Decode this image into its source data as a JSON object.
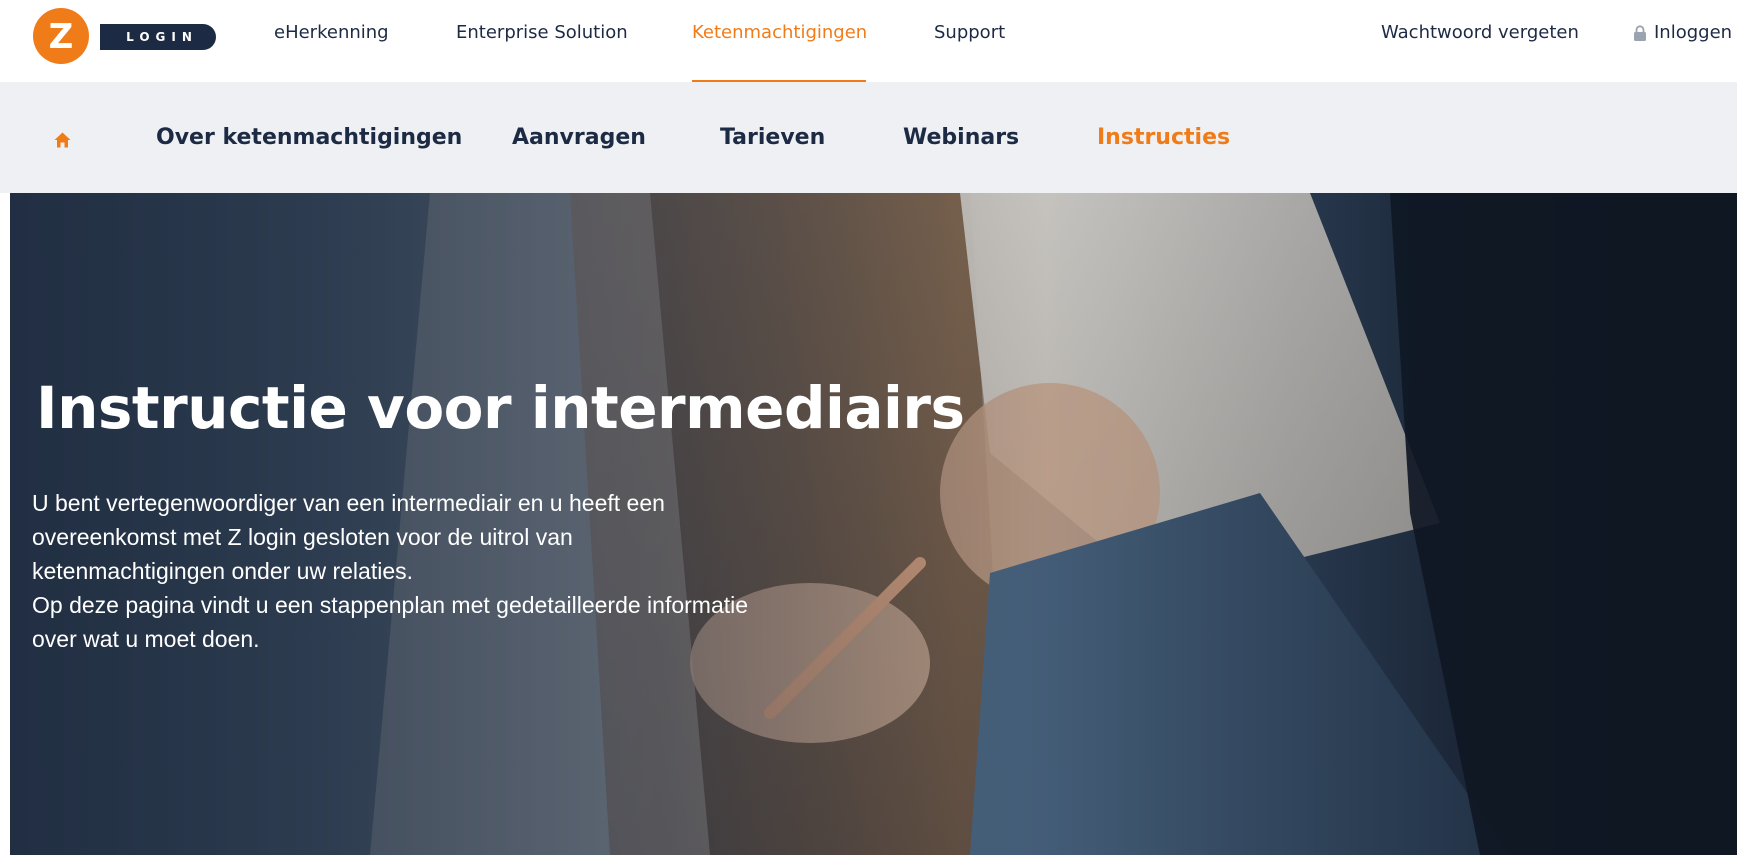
{
  "brand": {
    "logo_letter": "Z",
    "logo_word": "LOGIN",
    "orange": "#f07c19",
    "navy": "#1d2a44"
  },
  "top_nav": {
    "items": [
      {
        "label": "eHerkenning"
      },
      {
        "label": "Enterprise Solution"
      },
      {
        "label": "Ketenmachtigingen",
        "active": true
      },
      {
        "label": "Support"
      }
    ],
    "forgot_password": "Wachtwoord vergeten",
    "login": "Inloggen",
    "login_icon": "lock-icon"
  },
  "sub_nav": {
    "home_icon": "home-icon",
    "items": [
      {
        "label": "Over ketenmachtigingen"
      },
      {
        "label": "Aanvragen"
      },
      {
        "label": "Tarieven"
      },
      {
        "label": "Webinars"
      },
      {
        "label": "Instructies",
        "active": true
      }
    ]
  },
  "hero": {
    "title": "Instructie voor intermediairs",
    "lines": [
      "U bent vertegenwoordiger van een intermediair en u heeft een",
      "overeenkomst met Z login gesloten voor de uitrol van",
      "ketenmachtigingen onder uw relaties.",
      "Op deze pagina vindt u een stappenplan met gedetailleerde informatie",
      "over wat u moet doen."
    ]
  }
}
